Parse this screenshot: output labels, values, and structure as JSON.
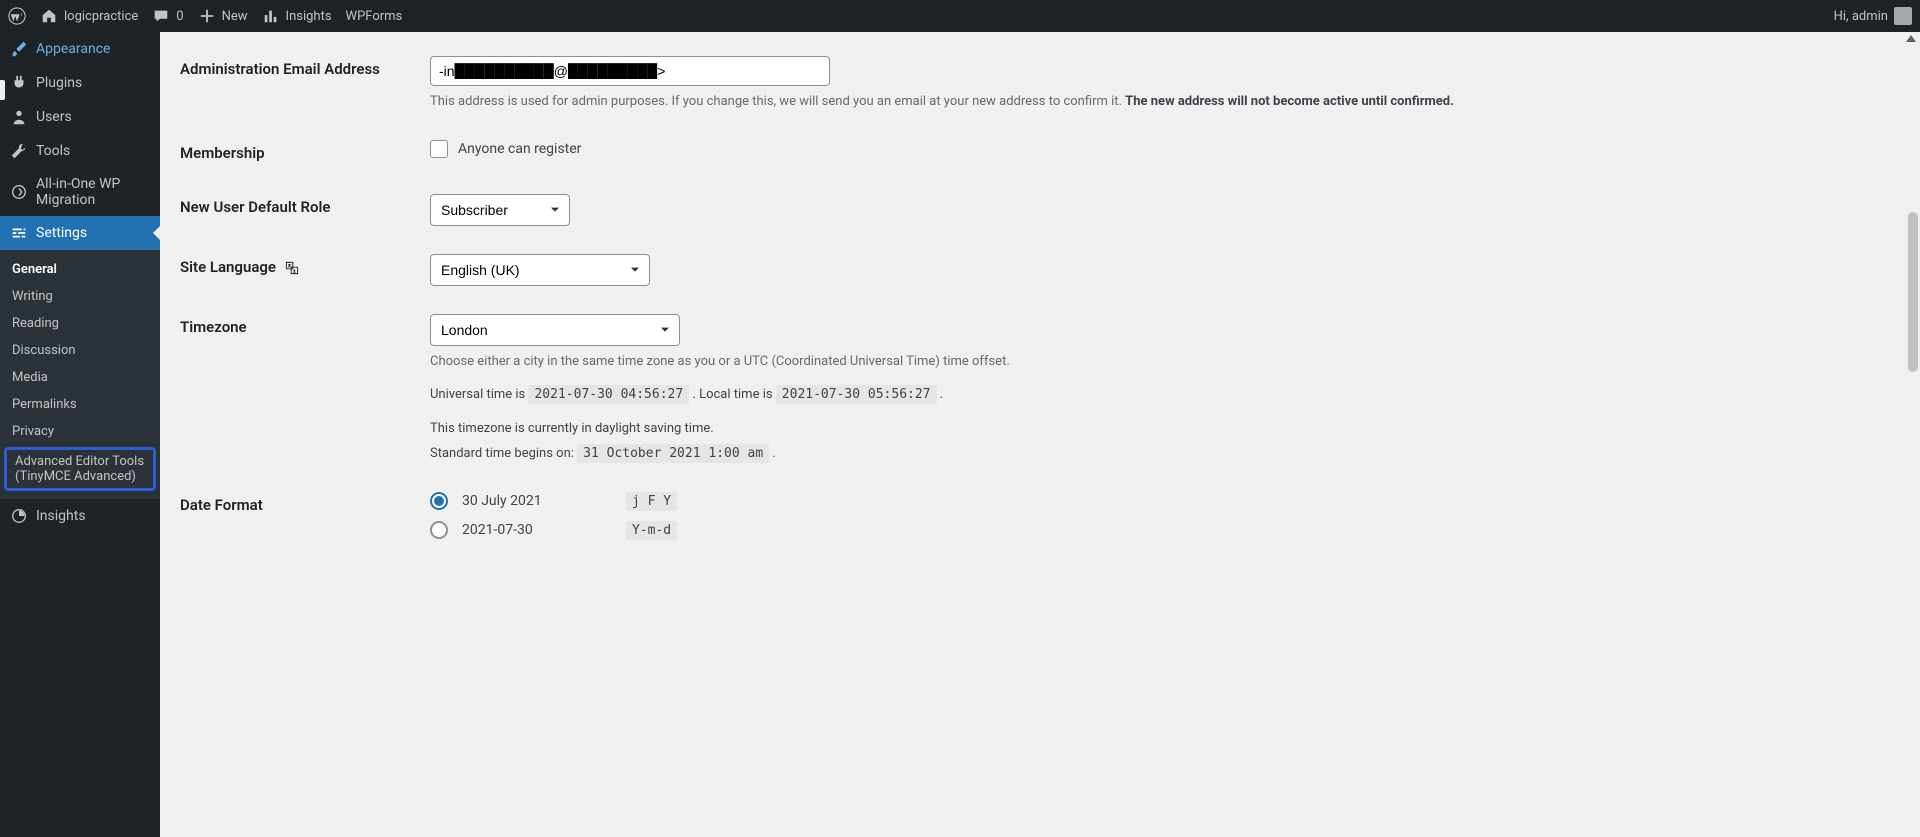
{
  "adminbar": {
    "site_name": "logicpractice",
    "comments_count": "0",
    "new_label": "New",
    "insights_label": "Insights",
    "wpforms_label": "WPForms",
    "greeting": "Hi, admin"
  },
  "sidebar": {
    "items": [
      {
        "label": "Appearance"
      },
      {
        "label": "Plugins"
      },
      {
        "label": "Users"
      },
      {
        "label": "Tools"
      },
      {
        "label": "All-in-One WP Migration"
      },
      {
        "label": "Settings"
      },
      {
        "label": "Insights"
      }
    ],
    "submenu": [
      {
        "label": "General"
      },
      {
        "label": "Writing"
      },
      {
        "label": "Reading"
      },
      {
        "label": "Discussion"
      },
      {
        "label": "Media"
      },
      {
        "label": "Permalinks"
      },
      {
        "label": "Privacy"
      },
      {
        "label": "Advanced Editor Tools (TinyMCE Advanced)"
      }
    ]
  },
  "form": {
    "admin_email": {
      "label": "Administration Email Address",
      "value": "-in██████████@█████████>",
      "help_prefix": "This address is used for admin purposes. If you change this, we will send you an email at your new address to confirm it. ",
      "help_bold": "The new address will not become active until confirmed."
    },
    "membership": {
      "label": "Membership",
      "checkbox_label": "Anyone can register"
    },
    "default_role": {
      "label": "New User Default Role",
      "value": "Subscriber"
    },
    "language": {
      "label": "Site Language",
      "value": "English (UK)"
    },
    "timezone": {
      "label": "Timezone",
      "value": "London",
      "help1": "Choose either a city in the same time zone as you or a UTC (Coordinated Universal Time) time offset.",
      "universal_label": "Universal time is ",
      "universal_value": "2021-07-30 04:56:27",
      "local_label": ". Local time is ",
      "local_value": "2021-07-30 05:56:27",
      "dst_note": "This timezone is currently in daylight saving time.",
      "std_label": "Standard time begins on: ",
      "std_value": "31 October 2021 1:00 am"
    },
    "date_format": {
      "label": "Date Format",
      "options": [
        {
          "display": "30 July 2021",
          "fmt": "j F Y",
          "checked": true
        },
        {
          "display": "2021-07-30",
          "fmt": "Y-m-d",
          "checked": false
        }
      ]
    }
  }
}
